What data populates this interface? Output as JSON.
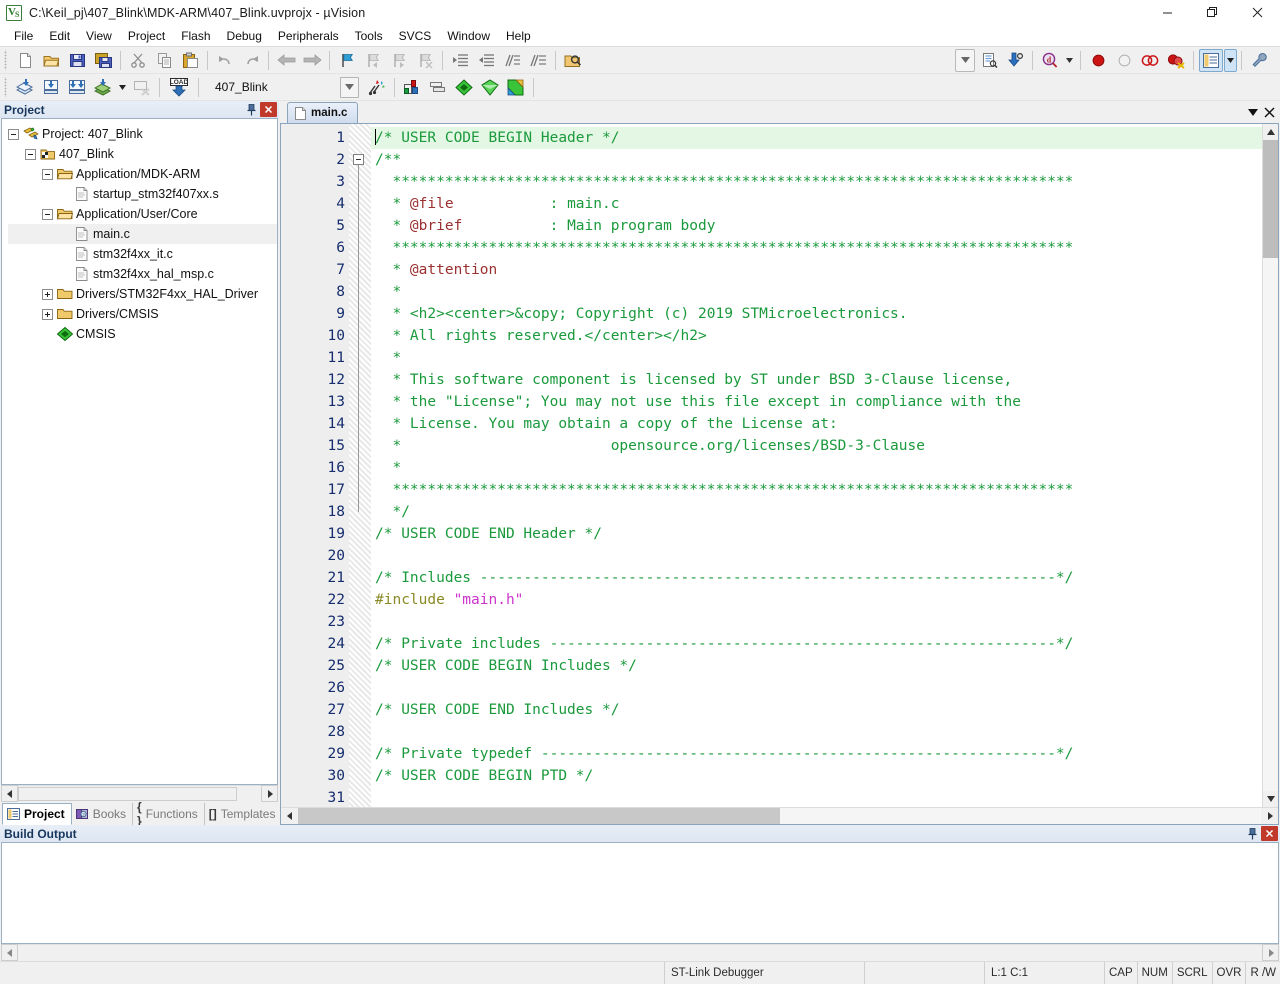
{
  "window": {
    "title": "C:\\Keil_pj\\407_Blink\\MDK-ARM\\407_Blink.uvprojx - µVision",
    "logo_v": "V",
    "logo_s": "S",
    "minimize_label": "Minimize",
    "maximize_label": "Restore",
    "close_label": "Close"
  },
  "menubar": {
    "items": [
      {
        "label": "File"
      },
      {
        "label": "Edit"
      },
      {
        "label": "View"
      },
      {
        "label": "Project"
      },
      {
        "label": "Flash"
      },
      {
        "label": "Debug"
      },
      {
        "label": "Peripherals"
      },
      {
        "label": "Tools"
      },
      {
        "label": "SVCS"
      },
      {
        "label": "Window"
      },
      {
        "label": "Help"
      }
    ]
  },
  "toolbar_main": {
    "buttons": [
      {
        "name": "new-file-icon",
        "tip": "New"
      },
      {
        "name": "open-file-icon",
        "tip": "Open"
      },
      {
        "name": "save-icon",
        "tip": "Save"
      },
      {
        "name": "save-all-icon",
        "tip": "Save All"
      },
      {
        "name": "cut-icon",
        "tip": "Cut"
      },
      {
        "name": "copy-icon",
        "tip": "Copy"
      },
      {
        "name": "paste-icon",
        "tip": "Paste"
      },
      {
        "name": "undo-icon",
        "tip": "Undo"
      },
      {
        "name": "redo-icon",
        "tip": "Redo"
      },
      {
        "name": "navigate-back-icon",
        "tip": "Back"
      },
      {
        "name": "navigate-forward-icon",
        "tip": "Forward"
      },
      {
        "name": "bookmark-toggle-icon",
        "tip": "Insert/Remove Bookmark"
      },
      {
        "name": "bookmark-prev-icon",
        "tip": "Previous Bookmark"
      },
      {
        "name": "bookmark-next-icon",
        "tip": "Next Bookmark"
      },
      {
        "name": "bookmark-clear-icon",
        "tip": "Clear All Bookmarks"
      },
      {
        "name": "indent-icon",
        "tip": "Indent"
      },
      {
        "name": "outdent-icon",
        "tip": "Outdent"
      },
      {
        "name": "comment-icon",
        "tip": "Comment Selection"
      },
      {
        "name": "uncomment-icon",
        "tip": "Uncomment Selection"
      },
      {
        "name": "find-in-files-icon",
        "tip": "Find in Files"
      }
    ],
    "right_buttons": [
      {
        "name": "combo-dropdown-icon",
        "tip": "History"
      },
      {
        "name": "source-browse-icon",
        "tip": "Source Browse"
      },
      {
        "name": "goto-definition-icon",
        "tip": "Go To Definition"
      },
      {
        "name": "find-icon",
        "tip": "Find"
      },
      {
        "name": "breakpoint-insert-icon",
        "tip": "Insert/Remove Breakpoint"
      },
      {
        "name": "breakpoint-disable-icon",
        "tip": "Enable/Disable Breakpoint"
      },
      {
        "name": "breakpoint-disable-all-icon",
        "tip": "Disable All Breakpoints"
      },
      {
        "name": "breakpoint-kill-all-icon",
        "tip": "Kill All Breakpoints"
      },
      {
        "name": "project-window-icon",
        "tip": "Project Window"
      },
      {
        "name": "configure-icon",
        "tip": "Configuration Wizard"
      }
    ]
  },
  "toolbar_build": {
    "buttons": [
      {
        "name": "translate-icon",
        "tip": "Translate"
      },
      {
        "name": "build-icon",
        "tip": "Build"
      },
      {
        "name": "rebuild-icon",
        "tip": "Rebuild"
      },
      {
        "name": "batch-build-icon",
        "tip": "Batch Build"
      },
      {
        "name": "stop-build-icon",
        "tip": "Stop Build"
      },
      {
        "name": "download-icon",
        "tip": "Download"
      },
      {
        "name": "target-options-icon",
        "tip": "Options for Target"
      },
      {
        "name": "manage-project-items-icon",
        "tip": "Manage Project Items"
      },
      {
        "name": "pack-installer-icon",
        "tip": "Pack Installer"
      },
      {
        "name": "manage-run-time-env-icon",
        "tip": "Manage Run-Time Environment"
      },
      {
        "name": "select-software-packs-icon",
        "tip": "Select Software Packs"
      }
    ],
    "target": {
      "value": "407_Blink",
      "dropdown_label": "Select Target"
    },
    "load_label": "LOAD"
  },
  "project_pane": {
    "caption": "Project",
    "pin_label": "Auto Hide",
    "close_label": "Close",
    "tree": [
      {
        "label": "Project: 407_Blink",
        "depth": 0,
        "icon": "project-icon",
        "state": "expanded",
        "selected": false
      },
      {
        "label": "407_Blink",
        "depth": 1,
        "icon": "target-icon",
        "state": "expanded",
        "selected": false
      },
      {
        "label": "Application/MDK-ARM",
        "depth": 2,
        "icon": "folder-open-icon",
        "state": "expanded",
        "selected": false
      },
      {
        "label": "startup_stm32f407xx.s",
        "depth": 3,
        "icon": "file-icon",
        "state": "leaf",
        "selected": false
      },
      {
        "label": "Application/User/Core",
        "depth": 2,
        "icon": "folder-open-icon",
        "state": "expanded",
        "selected": false
      },
      {
        "label": "main.c",
        "depth": 3,
        "icon": "file-icon",
        "state": "leaf",
        "selected": true
      },
      {
        "label": "stm32f4xx_it.c",
        "depth": 3,
        "icon": "file-icon",
        "state": "leaf",
        "selected": false
      },
      {
        "label": "stm32f4xx_hal_msp.c",
        "depth": 3,
        "icon": "file-icon",
        "state": "leaf",
        "selected": false
      },
      {
        "label": "Drivers/STM32F4xx_HAL_Driver",
        "depth": 2,
        "icon": "folder-closed-icon",
        "state": "collapsed",
        "selected": false
      },
      {
        "label": "Drivers/CMSIS",
        "depth": 2,
        "icon": "folder-closed-icon",
        "state": "collapsed",
        "selected": false
      },
      {
        "label": "CMSIS",
        "depth": 2,
        "icon": "cmsis-icon",
        "state": "leaf",
        "selected": false
      }
    ],
    "tabs": [
      {
        "label": "Project",
        "icon": "project-window-icon",
        "active": true
      },
      {
        "label": "Books",
        "icon": "books-icon",
        "active": false
      },
      {
        "label": "Functions",
        "icon": "functions-icon",
        "active": false
      },
      {
        "label": "Templates",
        "icon": "templates-icon",
        "active": false
      }
    ]
  },
  "editor": {
    "tabs": [
      {
        "label": "main.c",
        "icon": "file-icon",
        "active": true
      }
    ],
    "tab_menu_label": "Window List",
    "tab_close_label": "Close",
    "first_line_number": 1,
    "lines": [
      {
        "n": 1,
        "current": true,
        "fold": "none",
        "tokens": [
          {
            "t": "cmt",
            "v": "/* USER CODE BEGIN Header */"
          }
        ]
      },
      {
        "n": 2,
        "current": false,
        "fold": "box",
        "tokens": [
          {
            "t": "cmt",
            "v": "/**"
          }
        ]
      },
      {
        "n": 3,
        "current": false,
        "fold": "line",
        "tokens": [
          {
            "t": "cmt",
            "v": "  ******************************************************************************"
          }
        ]
      },
      {
        "n": 4,
        "current": false,
        "fold": "line",
        "tokens": [
          {
            "t": "cmt",
            "v": "  * "
          },
          {
            "t": "doctag",
            "v": "@file"
          },
          {
            "t": "cmt",
            "v": "           : main.c"
          }
        ]
      },
      {
        "n": 5,
        "current": false,
        "fold": "line",
        "tokens": [
          {
            "t": "cmt",
            "v": "  * "
          },
          {
            "t": "doctag",
            "v": "@brief"
          },
          {
            "t": "cmt",
            "v": "          : Main program body"
          }
        ]
      },
      {
        "n": 6,
        "current": false,
        "fold": "line",
        "tokens": [
          {
            "t": "cmt",
            "v": "  ******************************************************************************"
          }
        ]
      },
      {
        "n": 7,
        "current": false,
        "fold": "line",
        "tokens": [
          {
            "t": "cmt",
            "v": "  * "
          },
          {
            "t": "doctag",
            "v": "@attention"
          }
        ]
      },
      {
        "n": 8,
        "current": false,
        "fold": "line",
        "tokens": [
          {
            "t": "cmt",
            "v": "  *"
          }
        ]
      },
      {
        "n": 9,
        "current": false,
        "fold": "line",
        "tokens": [
          {
            "t": "cmt",
            "v": "  * <h2><center>&copy; Copyright (c) 2019 STMicroelectronics."
          }
        ]
      },
      {
        "n": 10,
        "current": false,
        "fold": "line",
        "tokens": [
          {
            "t": "cmt",
            "v": "  * All rights reserved.</center></h2>"
          }
        ]
      },
      {
        "n": 11,
        "current": false,
        "fold": "line",
        "tokens": [
          {
            "t": "cmt",
            "v": "  *"
          }
        ]
      },
      {
        "n": 12,
        "current": false,
        "fold": "line",
        "tokens": [
          {
            "t": "cmt",
            "v": "  * This software component is licensed by ST under BSD 3-Clause license,"
          }
        ]
      },
      {
        "n": 13,
        "current": false,
        "fold": "line",
        "tokens": [
          {
            "t": "cmt",
            "v": "  * the \"License\"; You may not use this file except in compliance with the"
          }
        ]
      },
      {
        "n": 14,
        "current": false,
        "fold": "line",
        "tokens": [
          {
            "t": "cmt",
            "v": "  * License. You may obtain a copy of the License at:"
          }
        ]
      },
      {
        "n": 15,
        "current": false,
        "fold": "line",
        "tokens": [
          {
            "t": "cmt",
            "v": "  *                        opensource.org/licenses/BSD-3-Clause"
          }
        ]
      },
      {
        "n": 16,
        "current": false,
        "fold": "line",
        "tokens": [
          {
            "t": "cmt",
            "v": "  *"
          }
        ]
      },
      {
        "n": 17,
        "current": false,
        "fold": "line",
        "tokens": [
          {
            "t": "cmt",
            "v": "  ******************************************************************************"
          }
        ]
      },
      {
        "n": 18,
        "current": false,
        "fold": "end",
        "tokens": [
          {
            "t": "cmt",
            "v": "  */"
          }
        ]
      },
      {
        "n": 19,
        "current": false,
        "fold": "none",
        "tokens": [
          {
            "t": "cmt",
            "v": "/* USER CODE END Header */"
          }
        ]
      },
      {
        "n": 20,
        "current": false,
        "fold": "none",
        "tokens": []
      },
      {
        "n": 21,
        "current": false,
        "fold": "none",
        "tokens": [
          {
            "t": "cmt",
            "v": "/* Includes ------------------------------------------------------------------*/"
          }
        ]
      },
      {
        "n": 22,
        "current": false,
        "fold": "none",
        "tokens": [
          {
            "t": "pp",
            "v": "#include "
          },
          {
            "t": "str",
            "v": "\"main.h\""
          }
        ]
      },
      {
        "n": 23,
        "current": false,
        "fold": "none",
        "tokens": []
      },
      {
        "n": 24,
        "current": false,
        "fold": "none",
        "tokens": [
          {
            "t": "cmt",
            "v": "/* Private includes ----------------------------------------------------------*/"
          }
        ]
      },
      {
        "n": 25,
        "current": false,
        "fold": "none",
        "tokens": [
          {
            "t": "cmt",
            "v": "/* USER CODE BEGIN Includes */"
          }
        ]
      },
      {
        "n": 26,
        "current": false,
        "fold": "none",
        "tokens": []
      },
      {
        "n": 27,
        "current": false,
        "fold": "none",
        "tokens": [
          {
            "t": "cmt",
            "v": "/* USER CODE END Includes */"
          }
        ]
      },
      {
        "n": 28,
        "current": false,
        "fold": "none",
        "tokens": []
      },
      {
        "n": 29,
        "current": false,
        "fold": "none",
        "tokens": [
          {
            "t": "cmt",
            "v": "/* Private typedef -----------------------------------------------------------*/"
          }
        ]
      },
      {
        "n": 30,
        "current": false,
        "fold": "none",
        "tokens": [
          {
            "t": "cmt",
            "v": "/* USER CODE BEGIN PTD */"
          }
        ]
      },
      {
        "n": 31,
        "current": false,
        "fold": "none",
        "tokens": []
      }
    ]
  },
  "build_output": {
    "caption": "Build Output",
    "pin_label": "Auto Hide",
    "close_label": "Close",
    "content": ""
  },
  "statusbar": {
    "message": "",
    "debugger": "ST-Link Debugger",
    "position": "L:1 C:1",
    "indicators": [
      {
        "label": "CAP"
      },
      {
        "label": "NUM"
      },
      {
        "label": "SCRL"
      },
      {
        "label": "OVR"
      },
      {
        "label": "R /W"
      }
    ]
  },
  "colors": {
    "comment": "#1a9a3c",
    "doctag": "#9b3030",
    "preprocessor": "#8a8a24",
    "string": "#cc33cc",
    "line_number": "#152d6e",
    "current_line_bg": "#e4f7e4",
    "caption_text": "#17365d",
    "close_badge": "#c0392b"
  }
}
